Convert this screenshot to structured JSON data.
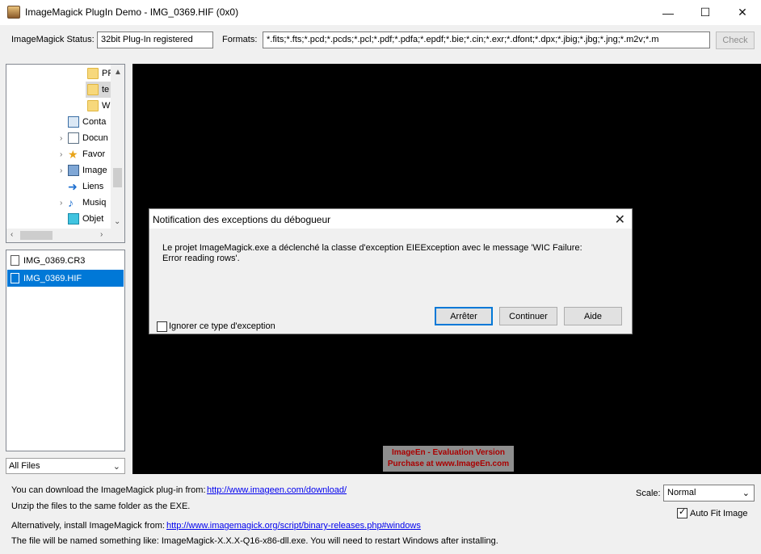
{
  "window": {
    "title": "ImageMagick PlugIn Demo - IMG_0369.HIF (0x0)",
    "minimize": "—",
    "maximize": "☐",
    "close": "✕"
  },
  "toolbar": {
    "status_label": "ImageMagick Status:",
    "status_value": "32bit Plug-In registered",
    "formats_label": "Formats:",
    "formats_value": "*.fits;*.fts;*.pcd;*.pcds;*.pcl;*.pdf;*.pdfa;*.epdf;*.bie;*.cin;*.exr;*.dfont;*.dpx;*.jbig;*.jbg;*.jng;*.m2v;*.m",
    "check_label": "Check"
  },
  "tree": {
    "items": [
      {
        "label": "PF",
        "icon": "folder-icon"
      },
      {
        "label": "te",
        "icon": "folder-icon"
      },
      {
        "label": "W",
        "icon": "folder-icon"
      },
      {
        "label": "Conta",
        "icon": "contacts-icon"
      },
      {
        "label": "Docun",
        "icon": "documents-icon"
      },
      {
        "label": "Favor",
        "icon": "star-icon"
      },
      {
        "label": "Image",
        "icon": "pictures-icon"
      },
      {
        "label": "Liens",
        "icon": "link-icon"
      },
      {
        "label": "Musiq",
        "icon": "music-icon"
      },
      {
        "label": "Objet",
        "icon": "3d-objects-icon"
      }
    ]
  },
  "files": {
    "items": [
      "IMG_0369.CR3",
      "IMG_0369.HIF"
    ],
    "selected": "IMG_0369.HIF",
    "filter": "All Files"
  },
  "watermark": {
    "line1": "ImageEn - Evaluation Version",
    "line2": "Purchase at www.ImageEn.com"
  },
  "dialog": {
    "title": "Notification des exceptions du débogueur",
    "message": "Le projet ImageMagick.exe a déclenché la classe d'exception EIEException avec le message 'WIC Failure: Error reading rows'.",
    "checkbox_label": "Ignorer ce type d'exception",
    "buttons": {
      "abort": "Arrêter",
      "continue": "Continuer",
      "help": "Aide"
    }
  },
  "footer": {
    "download_text": "You can download the ImageMagick plug-in from:",
    "download_link": "http://www.imageen.com/download/",
    "unzip_text": "Unzip the files to the same folder as the EXE.",
    "alt_text": "Alternatively, install ImageMagick from:",
    "alt_link": "http://www.imagemagick.org/script/binary-releases.php#windows",
    "named_text": "The file will be named something like: ImageMagick-X.X.X-Q16-x86-dll.exe. You will need to restart Windows after installing.",
    "scale_label": "Scale:",
    "scale_value": "Normal",
    "autofit_label": "Auto Fit Image",
    "autofit_checked": true
  }
}
